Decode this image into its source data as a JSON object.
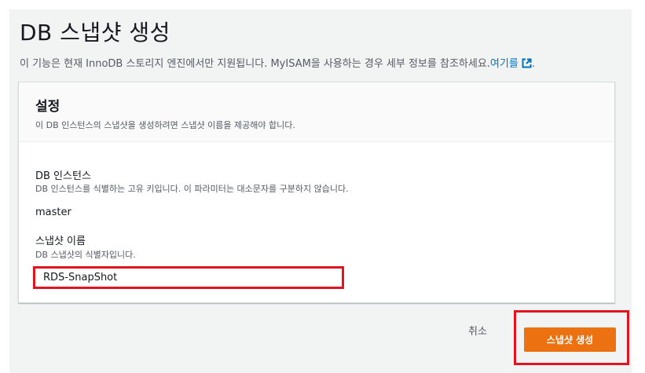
{
  "header": {
    "title": "DB 스냅샷 생성",
    "description": "이 기능은 현재 InnoDB 스토리지 엔진에서만 지원됩니다. MyISAM을 사용하는 경우 세부 정보를 참조하세요.",
    "link_text": "여기를",
    "link_suffix": "."
  },
  "settings": {
    "title": "설정",
    "description": "이 DB 인스턴스의 스냅샷을 생성하려면 스냅샷 이름을 제공해야 합니다.",
    "instance": {
      "label": "DB 인스턴스",
      "description": "DB 인스턴스를 식별하는 고유 키입니다. 이 파라미터는 대소문자를 구분하지 않습니다.",
      "value": "master"
    },
    "snapshot_name": {
      "label": "스냅샷 이름",
      "description": "DB 스냅샷의 식별자입니다.",
      "value": "RDS-SnapShot"
    }
  },
  "footer": {
    "cancel_label": "취소",
    "create_label": "스냅샷 생성"
  },
  "colors": {
    "primary_button": "#ec7211",
    "link": "#0073bb",
    "annotation": "#e2141f",
    "page_background": "#f2f3f3"
  },
  "icons": {
    "external_link": "external-link-icon"
  }
}
